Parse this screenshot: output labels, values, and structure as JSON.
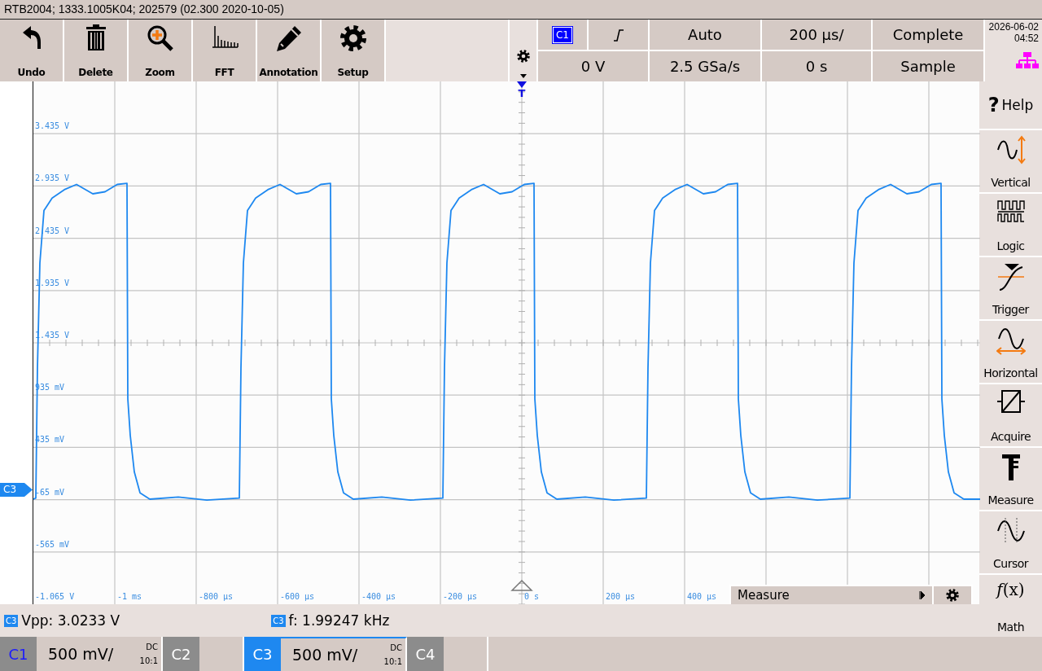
{
  "window": {
    "title": "RTB2004; 1333.1005K04; 202579 (02.300 2020-10-05)"
  },
  "toolbar": [
    {
      "kind": "undo",
      "label": "Undo"
    },
    {
      "kind": "delete",
      "label": "Delete"
    },
    {
      "kind": "zoom",
      "label": "Zoom"
    },
    {
      "kind": "fft",
      "label": "FFT"
    },
    {
      "kind": "annotation",
      "label": "Annotation"
    },
    {
      "kind": "setup",
      "label": "Setup"
    }
  ],
  "trigger": {
    "source": "C1",
    "level": "0 V",
    "mode": "Auto"
  },
  "acquisition": {
    "timebase": "200 µs/",
    "sample_rate": "2.5 GSa/s",
    "position": "0 s",
    "record": "Complete",
    "mode": "Sample"
  },
  "clock": {
    "date": "2026-06-02",
    "time": "04:52"
  },
  "side_menu": [
    {
      "kind": "help",
      "glyph": "?",
      "label": "Help"
    },
    {
      "kind": "vertical",
      "label": "Vertical"
    },
    {
      "kind": "logic",
      "label": "Logic"
    },
    {
      "kind": "trigger",
      "label": "Trigger"
    },
    {
      "kind": "horizontal",
      "label": "Horizontal"
    },
    {
      "kind": "acquire",
      "label": "Acquire"
    },
    {
      "kind": "measure",
      "label": "Measure"
    },
    {
      "kind": "cursor",
      "label": "Cursor"
    },
    {
      "kind": "math",
      "glyph": "*f*(x)",
      "label": "Math"
    }
  ],
  "plot": {
    "trigger_marker": "T",
    "channel_marker": "C3",
    "y_labels": [
      "3.435 V",
      "2.935 V",
      "2.435 V",
      "1.935 V",
      "1.435 V",
      "935 mV",
      "435 mV",
      "-65 mV",
      "-565 mV",
      "-1.065 V"
    ],
    "x_labels": [
      "-1 ms",
      "-800 µs",
      "-600 µs",
      "-400 µs",
      "-200 µs",
      "0 s",
      "200 µs",
      "400 µs"
    ]
  },
  "measure_panel": {
    "label": "Measure"
  },
  "measurements": [
    {
      "source": "C3",
      "text": "Vpp: 3.0233 V"
    },
    {
      "source": "C3",
      "text": "f: 1.99247 kHz"
    }
  ],
  "channels": [
    {
      "label": "C1",
      "on": true,
      "selected": false,
      "scale": "500 mV/",
      "coupling": "DC",
      "probe": "10:1"
    },
    {
      "label": "C2",
      "on": false,
      "selected": false
    },
    {
      "label": "C3",
      "on": true,
      "selected": true,
      "scale": "500 mV/",
      "coupling": "DC",
      "probe": "10:1"
    },
    {
      "label": "C4",
      "on": false,
      "selected": false
    }
  ]
}
